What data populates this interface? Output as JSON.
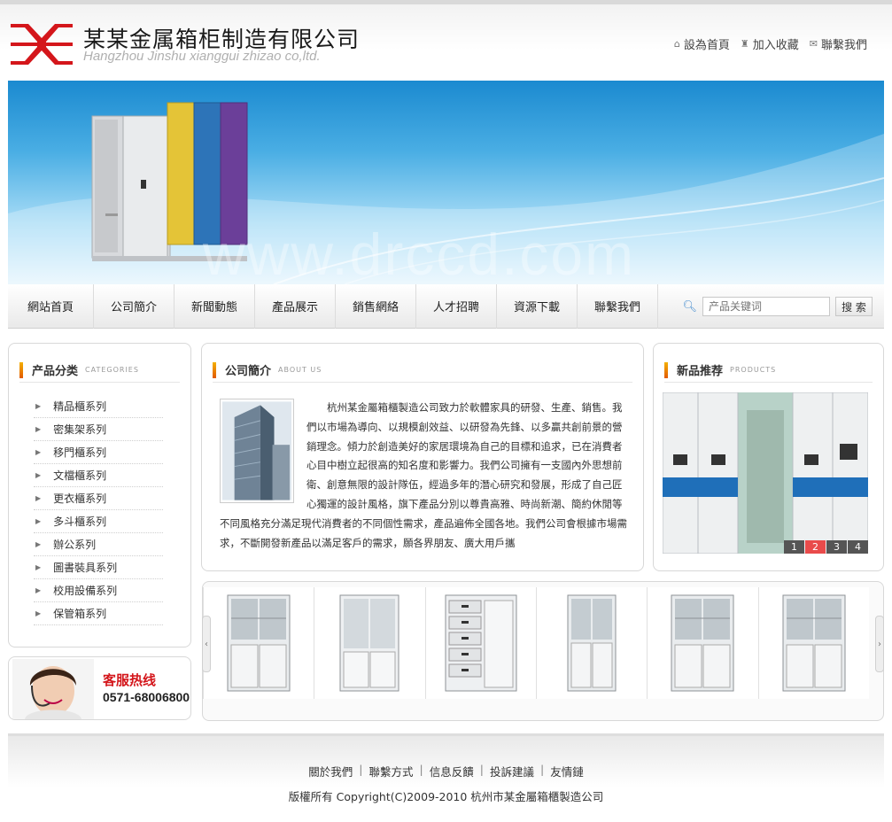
{
  "header": {
    "company_cn": "某某金属箱柜制造有限公司",
    "company_en": "Hangzhou Jinshu xianggui zhizao co,ltd.",
    "links": [
      {
        "label": "設為首頁",
        "icon": "home-icon"
      },
      {
        "label": "加入收藏",
        "icon": "bookmark-icon"
      },
      {
        "label": "聯繫我們",
        "icon": "contact-icon"
      }
    ]
  },
  "banner": {
    "watermark": "www.drccd.com"
  },
  "nav": {
    "items": [
      "網站首頁",
      "公司簡介",
      "新聞動態",
      "產品展示",
      "銷售網絡",
      "人才招聘",
      "資源下載",
      "聯繫我們"
    ],
    "search_placeholder": "产品关键词",
    "search_button": "搜 索"
  },
  "categories": {
    "title": "产品分类",
    "subtitle": "CATEGORIES",
    "items": [
      "精品櫃系列",
      "密集架系列",
      "移門櫃系列",
      "文檔櫃系列",
      "更衣櫃系列",
      "多斗櫃系列",
      "辦公系列",
      "圖書裝具系列",
      "校用設備系列",
      "保管箱系列"
    ]
  },
  "hotline": {
    "title": "客服热线",
    "number": "0571-68006800"
  },
  "about": {
    "title": "公司簡介",
    "subtitle": "ABOUT US",
    "text": "　　杭州某金屬箱櫃製造公司致力於軟體家具的研發、生產、銷售。我們以市場為導向、以規模創效益、以研發為先鋒、以多贏共創前景的營銷理念。傾力於創造美好的家居環境為自己的目標和追求，已在消費者心目中樹立起很高的知名度和影響力。我們公司擁有一支國內外思想前衛、創意無限的設計隊伍，經過多年的潛心研究和發展，形成了自己匠心獨運的設計風格，旗下產品分別以尊貴高雅、時尚新潮、簡約休閒等不同風格充分滿足現代消費者的不同個性需求，產品遍佈全國各地。我們公司會根據市場需求，不斷開發新產品以滿足客戶的需求，願各界朋友、廣大用戶攜"
  },
  "new_products": {
    "title": "新品推荐",
    "subtitle": "PRODUCTS",
    "pages": [
      "1",
      "2",
      "3",
      "4"
    ],
    "active_page": "2"
  },
  "footer": {
    "links": [
      "關於我們",
      "聯繫方式",
      "信息反饋",
      "投訴建議",
      "友情鏈"
    ],
    "copyright": "版權所有 Copyright(C)2009-2010 杭州市某金屬箱櫃製造公司"
  },
  "colors": {
    "accent_red": "#d4161b",
    "banner_blue": "#2a95d8",
    "bar_orange": "#e25a00"
  }
}
